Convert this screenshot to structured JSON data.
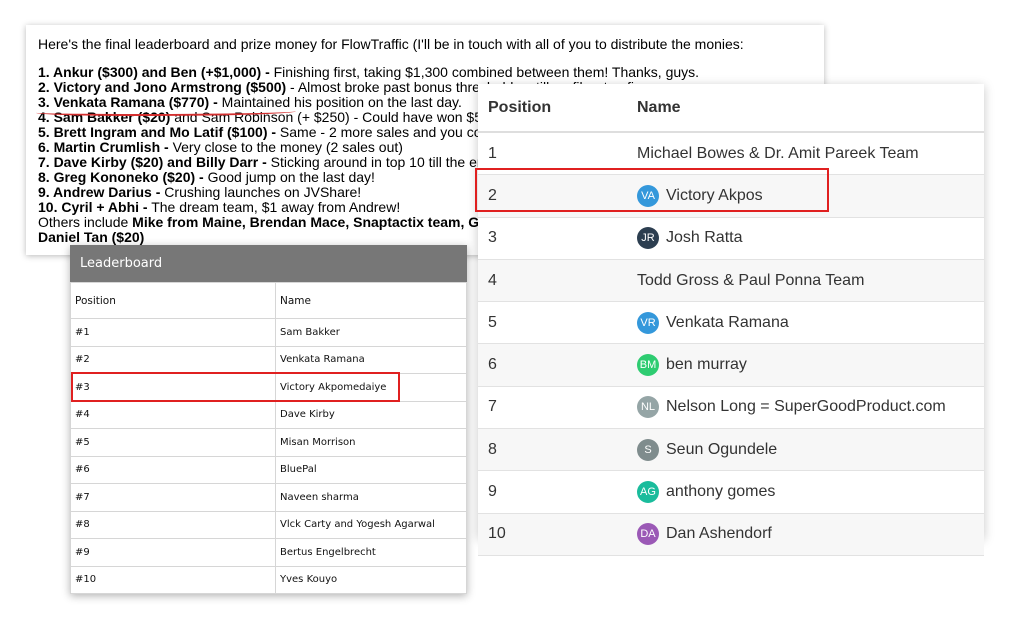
{
  "email": {
    "intro": "Here's the final leaderboard and prize money for FlowTraffic (I'll be in touch with all of you to distribute the monies:",
    "lines": [
      {
        "bold": "1. Ankur ($300) and Ben (+$1,000) -",
        "text": " Finishing first, taking $1,300 combined between them! Thanks, guys."
      },
      {
        "bold": "2. Victory and Jono Armstrong ($500)",
        "text": " - Almost broke past bonus threshold... still no fiber top five"
      },
      {
        "bold": "3. Venkata Ramana ($770) -",
        "text": " Maintained his position on the last day."
      },
      {
        "bold": "4. Sam Bakker ($20)",
        "text": " and Sam Robinson (+ $250) - Could have won $5"
      },
      {
        "bold": "5. Brett Ingram and Mo Latif ($100) -",
        "text": " Same - 2 more sales and you co"
      },
      {
        "bold": "6. Martin Crumlish -",
        "text": " Very close to the money (2 sales out)"
      },
      {
        "bold": "7. Dave Kirby ($20) and Billy Darr -",
        "text": " Sticking around in top 10 till the er"
      },
      {
        "bold": "8. Greg Kononeko ($20) -",
        "text": " Good jump on the last day!"
      },
      {
        "bold": "9. Andrew Darius -",
        "text": " Crushing launches on JVShare!"
      },
      {
        "bold": "10. Cyril + Abhi -",
        "text": " The dream team, $1 away from Andrew!"
      },
      {
        "bold": "",
        "text": "Others include ",
        "bold2": "Mike from Maine, Brendan Mace, Snaptactix team, G"
      },
      {
        "bold": "Daniel Tan ($20)",
        "text": ""
      }
    ]
  },
  "leaderboard": {
    "title": "Leaderboard",
    "col_position": "Position",
    "col_name": "Name",
    "rows": [
      {
        "pos": "#1",
        "name": "Sam Bakker"
      },
      {
        "pos": "#2",
        "name": "Venkata Ramana"
      },
      {
        "pos": "#3",
        "name": "Victory Akpomedaiye"
      },
      {
        "pos": "#4",
        "name": "Dave Kirby"
      },
      {
        "pos": "#5",
        "name": "Misan Morrison"
      },
      {
        "pos": "#6",
        "name": "BluePal"
      },
      {
        "pos": "#7",
        "name": "Naveen sharma"
      },
      {
        "pos": "#8",
        "name": "Vlck Carty and Yogesh Agarwal"
      },
      {
        "pos": "#9",
        "name": "Bertus Engelbrecht"
      },
      {
        "pos": "#10",
        "name": "Yves Kouyo"
      }
    ]
  },
  "panel": {
    "col_position": "Position",
    "col_name": "Name",
    "rows": [
      {
        "pos": "1",
        "name": "Michael Bowes & Dr. Amit Pareek Team",
        "avatar": "",
        "color": ""
      },
      {
        "pos": "2",
        "name": "Victory Akpos",
        "avatar": "VA",
        "color": "#3498db"
      },
      {
        "pos": "3",
        "name": "Josh Ratta",
        "avatar": "JR",
        "color": "#2c3e50"
      },
      {
        "pos": "4",
        "name": "Todd Gross & Paul Ponna Team",
        "avatar": "",
        "color": ""
      },
      {
        "pos": "5",
        "name": "Venkata Ramana",
        "avatar": "VR",
        "color": "#3498db"
      },
      {
        "pos": "6",
        "name": "ben murray",
        "avatar": "BM",
        "color": "#2ecc71"
      },
      {
        "pos": "7",
        "name": "Nelson Long = SuperGoodProduct.com",
        "avatar": "NL",
        "color": "#95a5a6"
      },
      {
        "pos": "8",
        "name": "Seun Ogundele",
        "avatar": "S",
        "color": "#7f8c8d"
      },
      {
        "pos": "9",
        "name": "anthony gomes",
        "avatar": "AG",
        "color": "#1abc9c"
      },
      {
        "pos": "10",
        "name": "Dan Ashendorf",
        "avatar": "DA",
        "color": "#9b59b6"
      }
    ]
  },
  "colors": {
    "highlight": "#e02020",
    "header_bg": "#777777"
  }
}
